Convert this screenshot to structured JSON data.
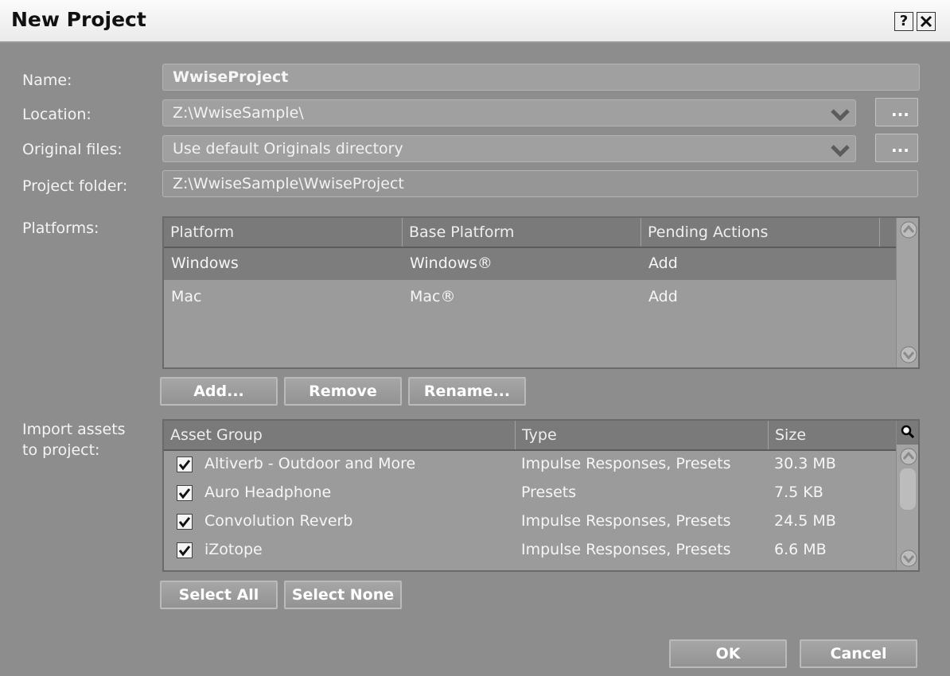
{
  "window": {
    "title": "New Project",
    "help": "?",
    "close": "✕"
  },
  "form": {
    "name_label": "Name:",
    "name_value": "WwiseProject",
    "location_label": "Location:",
    "location_value": "Z:\\WwiseSample\\",
    "location_browse": "...",
    "originals_label": "Original files:",
    "originals_value": "Use default Originals directory",
    "originals_browse": "...",
    "folder_label": "Project folder:",
    "folder_value": "Z:\\WwiseSample\\WwiseProject"
  },
  "platforms": {
    "label": "Platforms:",
    "columns": [
      "Platform",
      "Base Platform",
      "Pending Actions"
    ],
    "rows": [
      {
        "platform": "Windows",
        "base": "Windows®",
        "action": "Add",
        "selected": true
      },
      {
        "platform": "Mac",
        "base": "Mac®",
        "action": "Add",
        "selected": false
      }
    ],
    "buttons": {
      "add": "Add...",
      "remove": "Remove",
      "rename": "Rename..."
    }
  },
  "assets": {
    "label_line1": "Import assets",
    "label_line2": "to project:",
    "columns": [
      "Asset Group",
      "Type",
      "Size"
    ],
    "rows": [
      {
        "checked": true,
        "group": "Altiverb - Outdoor and More",
        "type": "Impulse Responses, Presets",
        "size": "30.3 MB"
      },
      {
        "checked": true,
        "group": "Auro Headphone",
        "type": "Presets",
        "size": "7.5 KB"
      },
      {
        "checked": true,
        "group": "Convolution Reverb",
        "type": "Impulse Responses, Presets",
        "size": "24.5 MB"
      },
      {
        "checked": true,
        "group": "iZotope",
        "type": "Impulse Responses, Presets",
        "size": "6.6 MB"
      }
    ],
    "buttons": {
      "select_all": "Select All",
      "select_none": "Select None"
    }
  },
  "footer": {
    "ok": "OK",
    "cancel": "Cancel"
  },
  "colors": {
    "panel": "#8d8d8d",
    "header": "#7a7a7a",
    "selected_row": "#7d7d7d"
  },
  "icons": [
    "help-icon",
    "close-icon",
    "chevron-down-icon",
    "scroll-up-icon",
    "scroll-down-icon",
    "search-icon",
    "checkbox-checked-icon"
  ]
}
